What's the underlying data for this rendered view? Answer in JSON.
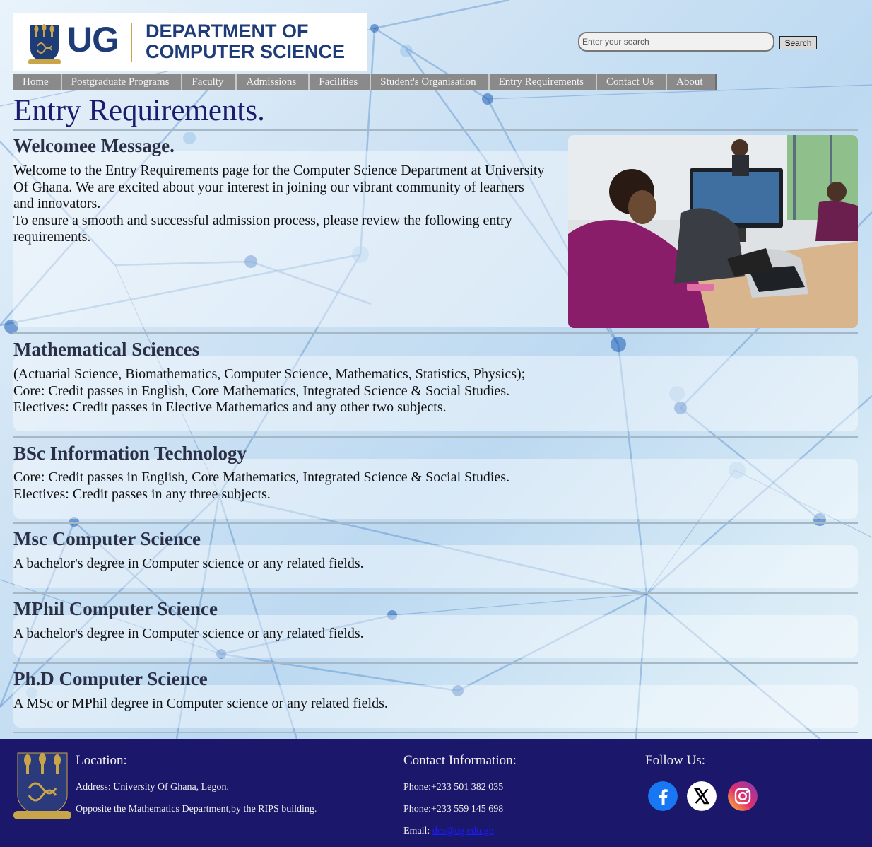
{
  "logo": {
    "short": "UG",
    "dept_line1": "DEPARTMENT OF",
    "dept_line2": "COMPUTER SCIENCE"
  },
  "search": {
    "placeholder": "Enter your search",
    "button_label": "Search"
  },
  "nav": [
    "Home",
    "Postgraduate Programs",
    "Faculty",
    "Admissions",
    "Facilities",
    "Student's Organisation",
    "Entry Requirements",
    "Contact Us",
    "About"
  ],
  "page_title": "Entry Requirements.",
  "welcome": {
    "title": "Welcomee Message.",
    "lines": [
      "Welcome to the Entry Requirements page for the Computer Science Department at University",
      "Of Ghana. We are excited about your interest in joining our vibrant community of learners",
      "and innovators.",
      "To ensure a smooth and successful admission process, please review the following entry",
      "requirements."
    ]
  },
  "sections": [
    {
      "title": "Mathematical Sciences",
      "lines": [
        "(Actuarial Science, Biomathematics, Computer Science, Mathematics, Statistics, Physics);",
        "Core: Credit passes in English, Core Mathematics, Integrated Science & Social Studies.",
        "Electives: Credit passes in Elective Mathematics and any other two subjects."
      ]
    },
    {
      "title": "BSc Information Technology",
      "lines": [
        "Core: Credit passes in English, Core Mathematics, Integrated Science & Social Studies.",
        "Electives: Credit passes in any three subjects."
      ]
    },
    {
      "title": "Msc Computer Science",
      "lines": [
        "A bachelor's degree in Computer science or any related fields."
      ]
    },
    {
      "title": "MPhil Computer Science",
      "lines": [
        "A bachelor's degree in Computer science or any related fields."
      ]
    },
    {
      "title": "Ph.D Computer Science",
      "lines": [
        "A MSc or MPhil degree in Computer science or any related fields."
      ]
    }
  ],
  "footer": {
    "location_heading": "Location:",
    "address": "Address: University Of Ghana, Legon.",
    "landmark": "Opposite the Mathematics Department,by the RIPS building.",
    "contact_heading": "Contact Information:",
    "phone1": "Phone:+233 501 382 035",
    "phone2": "Phone:+233 559 145 698",
    "email_label": "Email:",
    "email": "dcs@ug.edu.gh",
    "follow_heading": "Follow Us:",
    "social_icons": [
      "facebook-icon",
      "x-icon",
      "instagram-icon"
    ]
  },
  "colors": {
    "navy": "#1b186b",
    "title": "#1c1c6e",
    "nav": "#8a8a8a",
    "logo_blue": "#1d3c78",
    "gold": "#c9a54a"
  }
}
